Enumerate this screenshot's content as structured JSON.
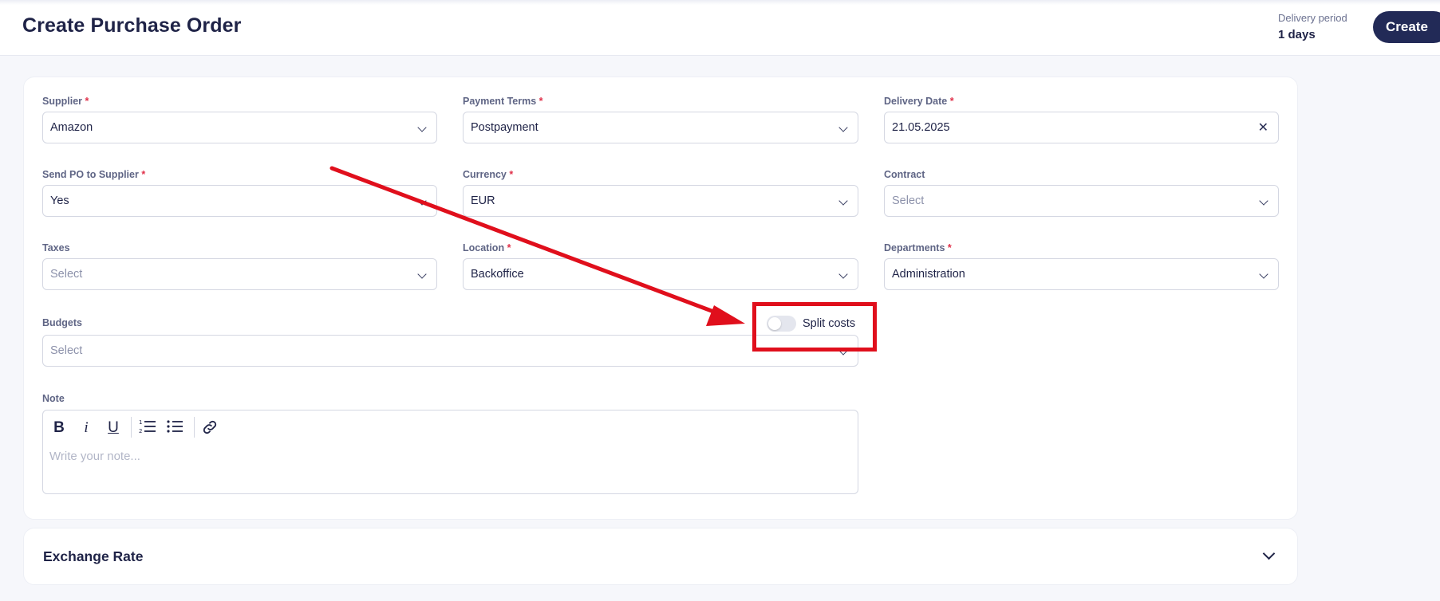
{
  "header": {
    "title": "Create Purchase Order",
    "delivery_period_label": "Delivery period",
    "delivery_period_value": "1 days",
    "create_label": "Create"
  },
  "form": {
    "supplier": {
      "label": "Supplier",
      "required": "*",
      "value": "Amazon"
    },
    "payment_terms": {
      "label": "Payment Terms",
      "required": "*",
      "value": "Postpayment"
    },
    "delivery_date": {
      "label": "Delivery Date",
      "required": "*",
      "value": "21.05.2025"
    },
    "send_po": {
      "label": "Send PO to Supplier",
      "required": "*",
      "value": "Yes"
    },
    "currency": {
      "label": "Currency",
      "required": "*",
      "value": "EUR"
    },
    "contract": {
      "label": "Contract",
      "placeholder": "Select"
    },
    "taxes": {
      "label": "Taxes",
      "placeholder": "Select"
    },
    "location": {
      "label": "Location",
      "required": "*",
      "value": "Backoffice"
    },
    "departments": {
      "label": "Departments",
      "required": "*",
      "value": "Administration"
    },
    "budgets": {
      "label": "Budgets",
      "placeholder": "Select"
    },
    "split_costs": {
      "label": "Split costs",
      "enabled": false
    },
    "note": {
      "label": "Note",
      "placeholder": "Write your note...",
      "toolbar": [
        "bold-icon",
        "italic-icon",
        "underline-icon",
        "ordered-list-icon",
        "bullet-list-icon",
        "link-icon"
      ]
    }
  },
  "exchange_rate": {
    "title": "Exchange Rate"
  },
  "annotation": {
    "color": "#e00f1c"
  },
  "colors": {
    "accent": "#222a57",
    "required": "#e0314a"
  }
}
